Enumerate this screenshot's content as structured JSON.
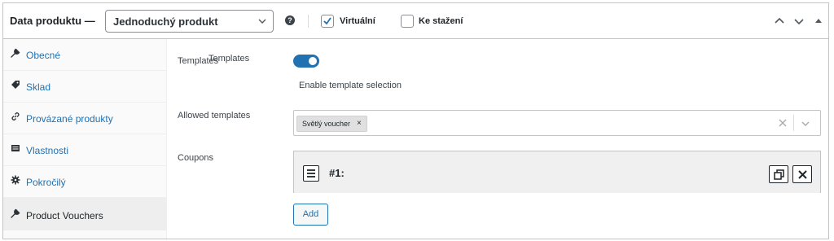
{
  "header": {
    "title": "Data produktu —",
    "product_type": "Jednoduchý produkt",
    "help_icon": "help-icon",
    "virtual": {
      "label": "Virtuální",
      "checked": true
    },
    "downloadable": {
      "label": "Ke stažení",
      "checked": false
    },
    "controls": [
      "chevron-up-icon",
      "chevron-down-icon",
      "toggle-arrow-icon"
    ]
  },
  "sidebar": {
    "items": [
      {
        "label": "Obecné",
        "icon": "wrench-icon",
        "active": false
      },
      {
        "label": "Sklad",
        "icon": "tag-icon",
        "active": false
      },
      {
        "label": "Provázané produkty",
        "icon": "link-icon",
        "active": false
      },
      {
        "label": "Vlastnosti",
        "icon": "list-icon",
        "active": false
      },
      {
        "label": "Pokročilý",
        "icon": "gear-icon",
        "active": false
      },
      {
        "label": "Product Vouchers",
        "icon": "wrench-icon",
        "active": true
      }
    ]
  },
  "fields": {
    "templates": {
      "label": "Templates",
      "label_overlap": "Templates",
      "enabled": true,
      "description": "Enable template selection"
    },
    "allowed_templates": {
      "label": "Allowed templates",
      "selected": [
        "Světlý voucher"
      ],
      "remove_symbol": "×"
    },
    "coupons": {
      "label": "Coupons",
      "items": [
        {
          "title": "#1:"
        }
      ],
      "add_label": "Add"
    }
  },
  "colors": {
    "accent": "#2271b1",
    "border": "#c3c4c7",
    "sidebar_bg": "#fafafa",
    "active_tab_bg": "#eeeeee"
  }
}
